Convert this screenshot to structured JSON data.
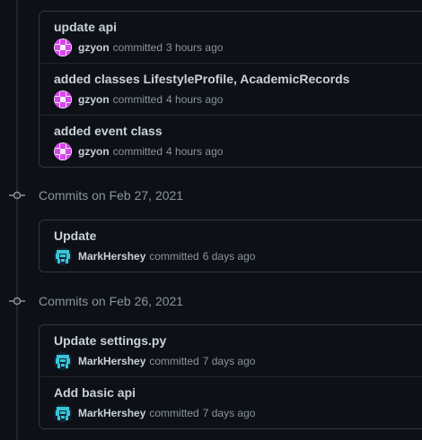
{
  "colors": {
    "background": "#0d1117",
    "border": "#30363d",
    "muted_text": "#8b949e",
    "primary_text": "#c9d1d9",
    "avatar_gzyon": "#d946ef",
    "avatar_markhershey": "#39c5d4"
  },
  "groups": [
    {
      "title": "",
      "commits": [
        {
          "message": "update api",
          "author": "gzyon",
          "verb": "committed",
          "time": "3 hours ago",
          "avatar": "gzyon-avatar"
        },
        {
          "message": "added classes LifestyleProfile, AcademicRecords",
          "author": "gzyon",
          "verb": "committed",
          "time": "4 hours ago",
          "avatar": "gzyon-avatar"
        },
        {
          "message": "added event class",
          "author": "gzyon",
          "verb": "committed",
          "time": "4 hours ago",
          "avatar": "gzyon-avatar"
        }
      ]
    },
    {
      "title": "Commits on Feb 27, 2021",
      "commits": [
        {
          "message": "Update",
          "author": "MarkHershey",
          "verb": "committed",
          "time": "6 days ago",
          "avatar": "markhershey-avatar"
        }
      ]
    },
    {
      "title": "Commits on Feb 26, 2021",
      "commits": [
        {
          "message": "Update settings.py",
          "author": "MarkHershey",
          "verb": "committed",
          "time": "7 days ago",
          "avatar": "markhershey-avatar"
        },
        {
          "message": "Add basic api",
          "author": "MarkHershey",
          "verb": "committed",
          "time": "7 days ago",
          "avatar": "markhershey-avatar"
        }
      ]
    }
  ]
}
